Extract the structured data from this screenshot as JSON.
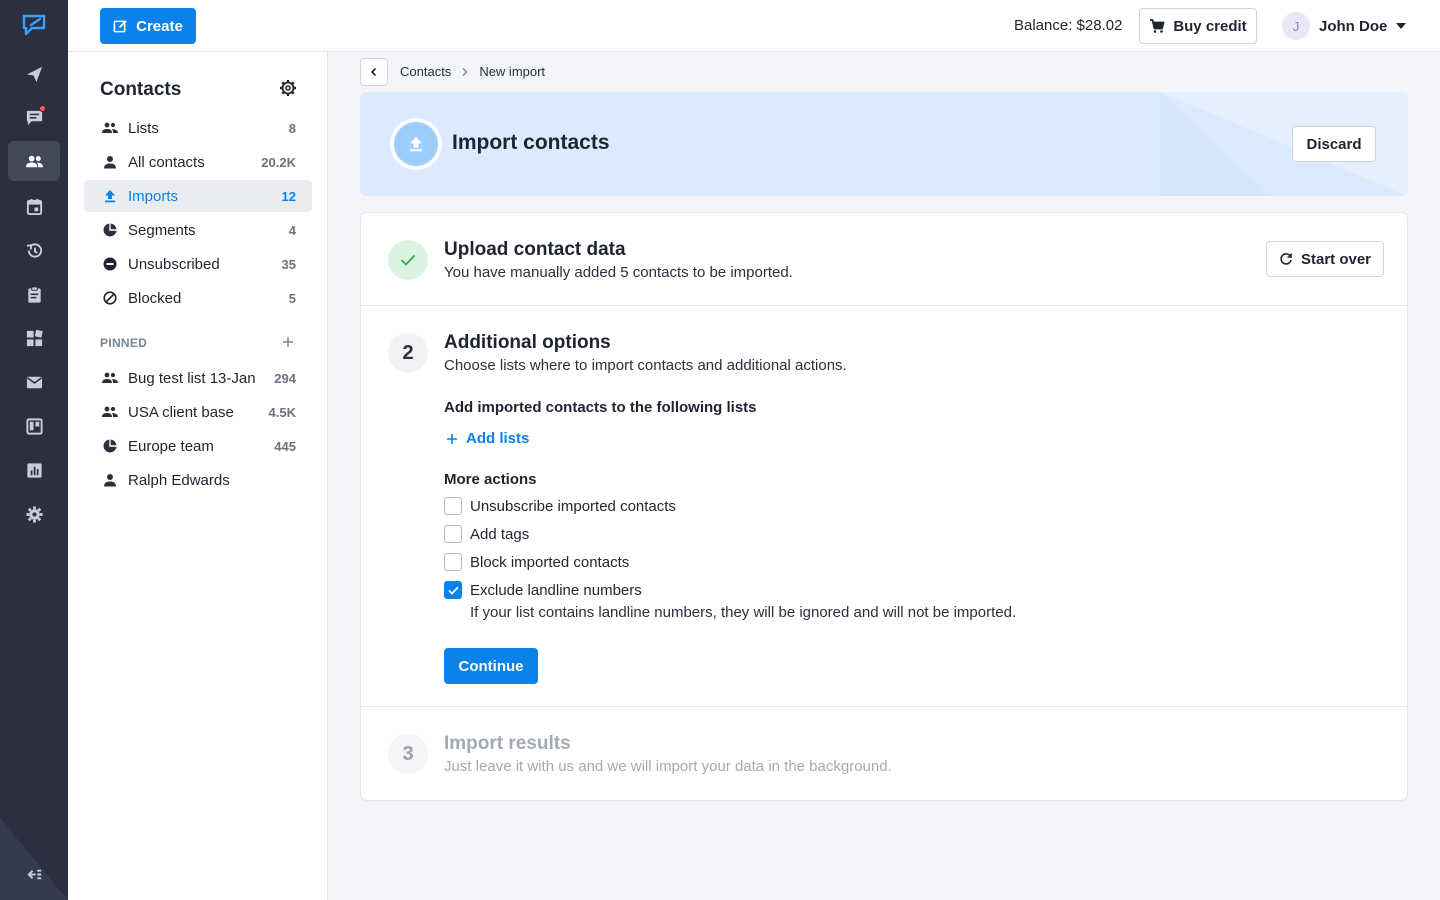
{
  "rail": {
    "items": [
      {
        "icon": "send-icon",
        "name": "rail-campaigns"
      },
      {
        "icon": "chat-icon",
        "name": "rail-messenger",
        "badge": true
      },
      {
        "icon": "contacts-icon",
        "name": "rail-contacts",
        "active": true
      },
      {
        "icon": "calendar-icon",
        "name": "rail-calendar"
      },
      {
        "icon": "history-icon",
        "name": "rail-history"
      },
      {
        "icon": "clipboard-icon",
        "name": "rail-templates"
      },
      {
        "icon": "apps-icon",
        "name": "rail-apps"
      },
      {
        "icon": "mail-icon",
        "name": "rail-email"
      },
      {
        "icon": "board-icon",
        "name": "rail-forms"
      },
      {
        "icon": "chart-icon",
        "name": "rail-analytics"
      },
      {
        "icon": "gear-icon",
        "name": "rail-settings"
      }
    ]
  },
  "topbar": {
    "create_label": "Create",
    "balance": "Balance: $28.02",
    "buy_label": "Buy credit",
    "user_initial": "J",
    "user_name": "John Doe"
  },
  "panel": {
    "title": "Contacts",
    "items": [
      {
        "label": "Lists",
        "count": "8",
        "icon": "people-icon"
      },
      {
        "label": "All contacts",
        "count": "20.2K",
        "icon": "person-icon"
      },
      {
        "label": "Imports",
        "count": "12",
        "icon": "upload-icon",
        "active": true
      },
      {
        "label": "Segments",
        "count": "4",
        "icon": "pie-icon"
      },
      {
        "label": "Unsubscribed",
        "count": "35",
        "icon": "minus-circle-icon"
      },
      {
        "label": "Blocked",
        "count": "5",
        "icon": "block-icon"
      }
    ],
    "pinned_label": "PINNED",
    "pinned": [
      {
        "label": "Bug test list 13-Jan",
        "count": "294",
        "icon": "people-icon"
      },
      {
        "label": "USA client base",
        "count": "4.5K",
        "icon": "people-icon"
      },
      {
        "label": "Europe team",
        "count": "445",
        "icon": "pie-icon"
      },
      {
        "label": "Ralph Edwards",
        "count": "",
        "icon": "person-icon"
      }
    ]
  },
  "breadcrumb": {
    "items": [
      "Contacts",
      "New import"
    ]
  },
  "banner": {
    "title": "Import contacts",
    "discard_label": "Discard"
  },
  "steps": {
    "step1": {
      "title": "Upload contact data",
      "desc": "You have manually added 5 contacts to be imported.",
      "startover_label": "Start over"
    },
    "step2": {
      "number": "2",
      "title": "Additional options",
      "desc": "Choose lists where to import contacts and additional actions.",
      "lists_heading": "Add imported contacts to the following lists",
      "add_lists_label": "Add lists",
      "more_actions_heading": "More actions",
      "options": [
        {
          "label": "Unsubscribe imported contacts",
          "checked": false
        },
        {
          "label": "Add tags",
          "checked": false
        },
        {
          "label": "Block imported contacts",
          "checked": false
        },
        {
          "label": "Exclude landline numbers",
          "checked": true
        }
      ],
      "landline_hint": "If your list contains landline numbers, they will be ignored and will not be imported.",
      "continue_label": "Continue"
    },
    "step3": {
      "number": "3",
      "title": "Import results",
      "desc": "Just leave it with us and we will import your data in the background."
    }
  },
  "colors": {
    "accent": "#0a82ea",
    "rail_bg": "#2b2f40",
    "banner_bg": "#dbeafd",
    "success_bg": "#ddf3e2"
  }
}
